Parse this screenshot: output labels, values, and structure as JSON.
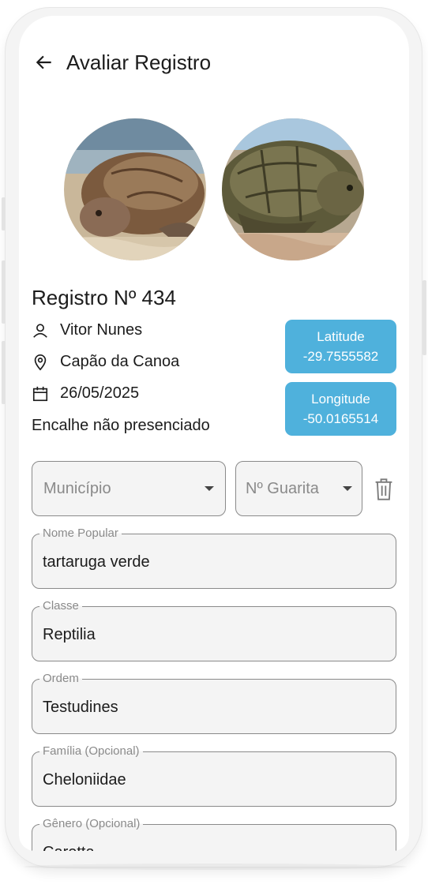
{
  "header": {
    "title": "Avaliar Registro",
    "back_icon": "arrow-left-icon"
  },
  "photos": [
    {
      "name": "turtle-photo-1"
    },
    {
      "name": "turtle-photo-2"
    }
  ],
  "record": {
    "title": "Registro Nº 434",
    "user": "Vitor Nunes",
    "location": "Capão da Canoa",
    "date": "26/05/2025",
    "status": "Encalhe não presenciado"
  },
  "coordinates": {
    "latitude_label": "Latitude",
    "latitude_value": "-29.7555582",
    "longitude_label": "Longitude",
    "longitude_value": "-50.0165514"
  },
  "dropdowns": {
    "municipio_placeholder": "Município",
    "guarita_placeholder": "Nº Guarita"
  },
  "fields": [
    {
      "label": "Nome Popular",
      "value": "tartaruga verde"
    },
    {
      "label": "Classe",
      "value": "Reptilia"
    },
    {
      "label": "Ordem",
      "value": "Testudines"
    },
    {
      "label": "Família (Opcional)",
      "value": "Cheloniidae"
    },
    {
      "label": "Gênero (Opcional)",
      "value": "Caretta"
    }
  ],
  "colors": {
    "accent": "#4fb1dc",
    "field_bg": "#f4f4f4",
    "border": "#8a8a8a",
    "text": "#1c1c1c"
  }
}
